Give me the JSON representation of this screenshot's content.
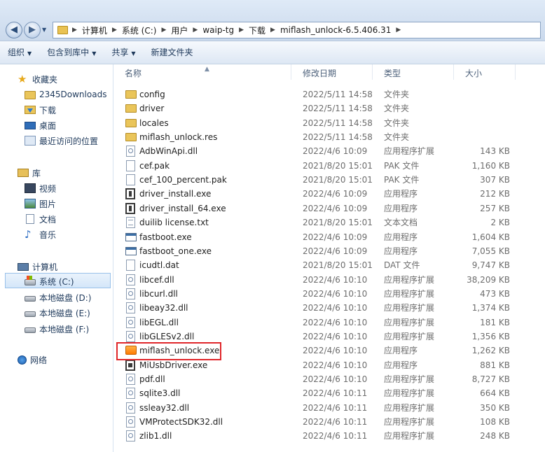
{
  "address_bar": {
    "breadcrumbs": [
      "计算机",
      "系统 (C:)",
      "用户",
      "waip-tg",
      "下载",
      "miflash_unlock-6.5.406.31"
    ]
  },
  "toolbar": {
    "organize": "组织",
    "include_in_library": "包含到库中",
    "share": "共享",
    "new_folder": "新建文件夹"
  },
  "nav": {
    "favorites": "收藏夹",
    "fav_2345": "2345Downloads",
    "fav_downloads": "下载",
    "fav_desktop": "桌面",
    "fav_recent": "最近访问的位置",
    "libraries": "库",
    "lib_video": "视频",
    "lib_pictures": "图片",
    "lib_docs": "文档",
    "lib_music": "音乐",
    "computer": "计算机",
    "drive_c": "系统 (C:)",
    "drive_d": "本地磁盘 (D:)",
    "drive_e": "本地磁盘 (E:)",
    "drive_f": "本地磁盘 (F:)",
    "network": "网络"
  },
  "columns": {
    "name": "名称",
    "date": "修改日期",
    "type": "类型",
    "size": "大小"
  },
  "files": [
    {
      "name": "config",
      "date": "2022/5/11 14:58",
      "type": "文件夹",
      "size": "",
      "icon": "folder"
    },
    {
      "name": "driver",
      "date": "2022/5/11 14:58",
      "type": "文件夹",
      "size": "",
      "icon": "folder"
    },
    {
      "name": "locales",
      "date": "2022/5/11 14:58",
      "type": "文件夹",
      "size": "",
      "icon": "folder"
    },
    {
      "name": "miflash_unlock.res",
      "date": "2022/5/11 14:58",
      "type": "文件夹",
      "size": "",
      "icon": "folder"
    },
    {
      "name": "AdbWinApi.dll",
      "date": "2022/4/6 10:09",
      "type": "应用程序扩展",
      "size": "143 KB",
      "icon": "dll"
    },
    {
      "name": "cef.pak",
      "date": "2021/8/20 15:01",
      "type": "PAK 文件",
      "size": "1,160 KB",
      "icon": "file"
    },
    {
      "name": "cef_100_percent.pak",
      "date": "2021/8/20 15:01",
      "type": "PAK 文件",
      "size": "307 KB",
      "icon": "file"
    },
    {
      "name": "driver_install.exe",
      "date": "2022/4/6 10:09",
      "type": "应用程序",
      "size": "212 KB",
      "icon": "setup"
    },
    {
      "name": "driver_install_64.exe",
      "date": "2022/4/6 10:09",
      "type": "应用程序",
      "size": "257 KB",
      "icon": "setup"
    },
    {
      "name": "duilib license.txt",
      "date": "2021/8/20 15:01",
      "type": "文本文档",
      "size": "2 KB",
      "icon": "txt"
    },
    {
      "name": "fastboot.exe",
      "date": "2022/4/6 10:09",
      "type": "应用程序",
      "size": "1,604 KB",
      "icon": "app"
    },
    {
      "name": "fastboot_one.exe",
      "date": "2022/4/6 10:09",
      "type": "应用程序",
      "size": "7,055 KB",
      "icon": "app"
    },
    {
      "name": "icudtl.dat",
      "date": "2021/8/20 15:01",
      "type": "DAT 文件",
      "size": "9,747 KB",
      "icon": "file"
    },
    {
      "name": "libcef.dll",
      "date": "2022/4/6 10:10",
      "type": "应用程序扩展",
      "size": "38,209 KB",
      "icon": "dll"
    },
    {
      "name": "libcurl.dll",
      "date": "2022/4/6 10:10",
      "type": "应用程序扩展",
      "size": "473 KB",
      "icon": "dll"
    },
    {
      "name": "libeay32.dll",
      "date": "2022/4/6 10:10",
      "type": "应用程序扩展",
      "size": "1,374 KB",
      "icon": "dll"
    },
    {
      "name": "libEGL.dll",
      "date": "2022/4/6 10:10",
      "type": "应用程序扩展",
      "size": "181 KB",
      "icon": "dll"
    },
    {
      "name": "libGLESv2.dll",
      "date": "2022/4/6 10:10",
      "type": "应用程序扩展",
      "size": "1,356 KB",
      "icon": "dll"
    },
    {
      "name": "miflash_unlock.exe",
      "date": "2022/4/6 10:10",
      "type": "应用程序",
      "size": "1,262 KB",
      "icon": "orange"
    },
    {
      "name": "MiUsbDriver.exe",
      "date": "2022/4/6 10:10",
      "type": "应用程序",
      "size": "881 KB",
      "icon": "usb"
    },
    {
      "name": "pdf.dll",
      "date": "2022/4/6 10:10",
      "type": "应用程序扩展",
      "size": "8,727 KB",
      "icon": "dll"
    },
    {
      "name": "sqlite3.dll",
      "date": "2022/4/6 10:11",
      "type": "应用程序扩展",
      "size": "664 KB",
      "icon": "dll"
    },
    {
      "name": "ssleay32.dll",
      "date": "2022/4/6 10:11",
      "type": "应用程序扩展",
      "size": "350 KB",
      "icon": "dll"
    },
    {
      "name": "VMProtectSDK32.dll",
      "date": "2022/4/6 10:11",
      "type": "应用程序扩展",
      "size": "108 KB",
      "icon": "dll"
    },
    {
      "name": "zlib1.dll",
      "date": "2022/4/6 10:11",
      "type": "应用程序扩展",
      "size": "248 KB",
      "icon": "dll"
    }
  ],
  "highlight_color": "#e0262a"
}
